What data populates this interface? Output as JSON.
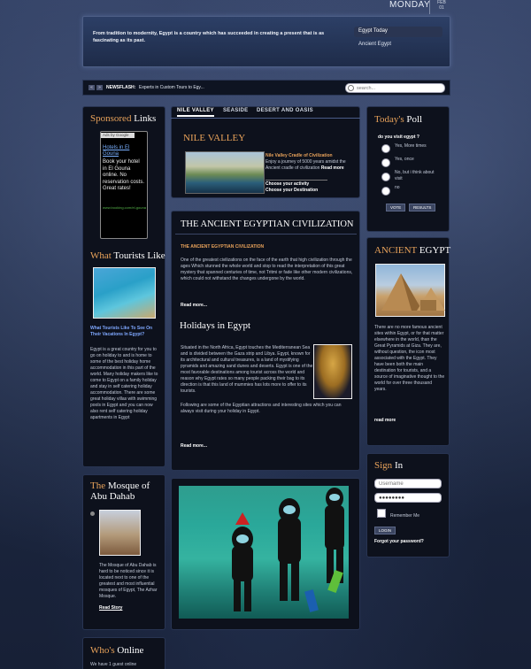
{
  "top": {
    "day": "MONDAY",
    "month": "FEB",
    "date": "01"
  },
  "header": {
    "tagline": "From tradition to modernity, Egypt is a country which has succeeded in creating a present that is as fascinating as its past.",
    "tabs": [
      "Egypt Today",
      "Ancient Egypt"
    ]
  },
  "newsbar": {
    "prev": "«",
    "next": "»",
    "label": "NEWSFLASH:",
    "text": "Experts in Custom Tours to Egy...",
    "search_placeholder": "search..."
  },
  "sponsored": {
    "title_hl": "Sponsored",
    "title_rest": " Links",
    "ads_by": "Ads by Google",
    "link": "Hotels in El Gouna",
    "text": "Book your hotel in El Gouna online. No reservation costs. Great rates!",
    "url": "www.booking.com/el-gouna"
  },
  "tourists": {
    "title_hl": "What",
    "title_rest": " Tourists Like",
    "headline": "What Tourists Like To See On Their Vacations In Egypt?",
    "body": "Egypt is a great country for you to go on holiday to and is home to some of the best holiday home accommodation in this part of the world. Many holiday makers like to come to Egypt on a family holiday and stay in self catering holiday accommodation. There are some great holiday villas with swimming pools in Egypt and you can now also rent self catering holiday apartments in Egypt"
  },
  "mosque": {
    "title_hl": "The",
    "title_rest": " Mosque of Abu Dahab",
    "body": "The Mosque of Abu Dahab is hard to be noticed since it is located next to one of the greatest and most influential mosques of Egypt, The Azhar Mosque.",
    "read": "Read Story"
  },
  "online": {
    "title_hl": "Who's",
    "title_rest": " Online",
    "text": "We have 1 guest online"
  },
  "tabs": [
    "NILE VALLEY",
    "SEASIDE",
    "DESERT AND OASIS"
  ],
  "nile": {
    "title_hl": "NILE",
    "title_rest": " VALLEY",
    "headline": "Nile Valley Cradle of Civilization",
    "text": "Enjoy a journey of 5000 years amidst the Ancient cradle of civilization",
    "read": "Read more",
    "choose1": "Choose your activity",
    "choose2": "Choose your Destination"
  },
  "ancient": {
    "title": "THE ANCIENT EGYPTIAN CIVILIZATION",
    "subtitle": "THE ANCIENT EGYPTIAN CIVILIZATION",
    "body": "One of the greatest civilizations on the face of the earth that high civilization through the ages Which stunned the whole world and stop to read the interpretation of this great mystery that spanned centuries of time, not Tritmi or fade like other modern civilizations, which could not withstand the changes undergone by the world.",
    "read": "Read more..."
  },
  "holidays": {
    "title": "Holidays in Egypt",
    "body1": "Situated in the North Africa, Egypt touches the Mediterranean Sea and is divided between the Gaza strip and Libya. Egypt, known for its architectural and cultural treasures, is a land of mystifying pyramids and amazing sand dunes and deserts. Egypt is one of the most favorable destinations among tourist across the world and reason why Egypt rates so many people packing their bag to its direction is that this land of mummies has lots more to offer to its tourists.",
    "body2": "Following are some of the Egyptian attractions and interesting sites which you can always visit during your holiday in Egypt.",
    "read": "Read more..."
  },
  "poll": {
    "title_hl": "Today's",
    "title_rest": " Poll",
    "question": "do you visit egypt ?",
    "options": [
      "Yes, More times",
      "Yes, once",
      "No, but i think about visit",
      "no"
    ],
    "vote": "VOTE",
    "results": "RESULTS"
  },
  "ancient_egypt": {
    "title_hl": "ANCIENT",
    "title_rest": " EGYPT",
    "body": "There are no more famous ancient sites within Egypt, or for that matter elsewhere in the world, than the Great Pyramids at Giza. They are, without question, the icon most associated with the Egypt. They have been both the main destination for tourists, and a source of imaginative thought to the world for over three thousand years.",
    "read": "read more"
  },
  "signin": {
    "title_hl": "Sign",
    "title_rest": " In",
    "username": "Username",
    "password": "●●●●●●●●",
    "remember": "Remember Me",
    "login": "LOGIN",
    "forgot": "Forgot your password?"
  },
  "colors": {
    "accent": "#e8a25a",
    "panel": "#0d111c",
    "link": "#7fa8ff"
  }
}
